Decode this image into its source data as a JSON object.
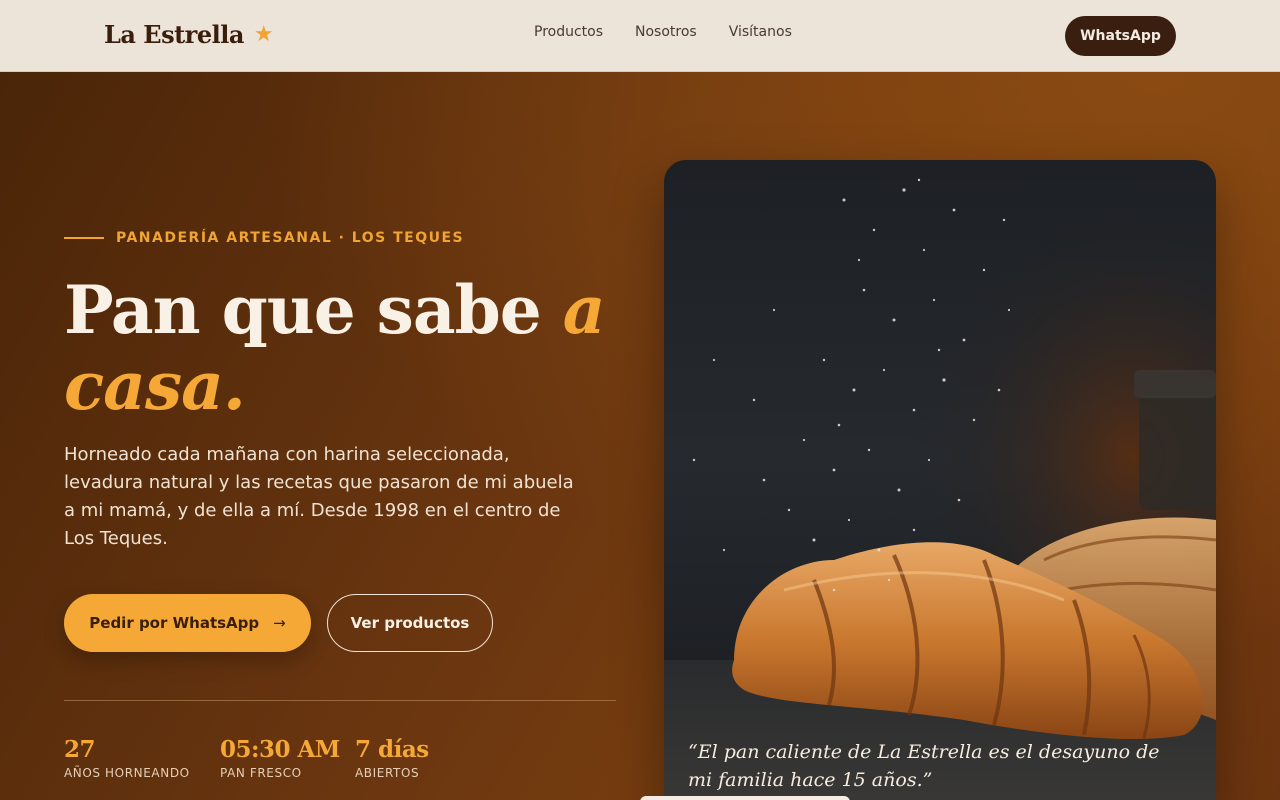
{
  "header": {
    "brand": "La Estrella",
    "star": "★",
    "nav": [
      "Productos",
      "Nosotros",
      "Visítanos"
    ],
    "whatsapp_label": "WhatsApp"
  },
  "hero": {
    "eyebrow": "PANADERÍA ARTESANAL · LOS TEQUES",
    "headline_main": "Pan que sabe ",
    "headline_accent": "a casa.",
    "lead": "Horneado cada mañana con harina seleccionada, levadura natural y las recetas que pasaron de mi abuela a mi mamá, y de ella a mí. Desde 1998 en el centro de Los Teques.",
    "primary_button": "Pedir por WhatsApp",
    "primary_arrow": "→",
    "secondary_button": "Ver productos",
    "stats": [
      {
        "value": "27",
        "label": "AÑOS HORNEANDO"
      },
      {
        "value": "05:30 AM",
        "label": "PAN FRESCO"
      },
      {
        "value": "7 días",
        "label": "ABIERTOS"
      }
    ],
    "photo_quote": "“El pan caliente de La Estrella es el desayuno de mi familia hace 15 años.”"
  },
  "colors": {
    "accent": "#f5a836",
    "dark_brown": "#3a1f10",
    "header_bg": "#ece3d9"
  }
}
